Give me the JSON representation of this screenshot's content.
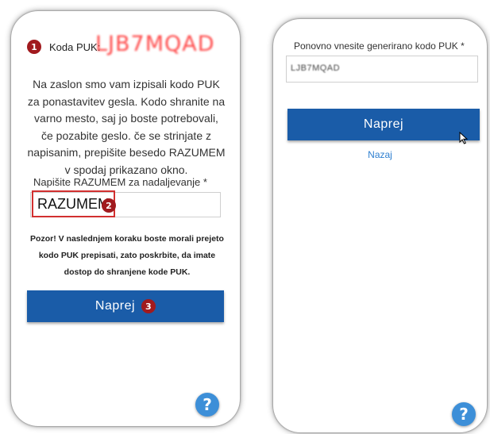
{
  "left_screen": {
    "step1_badge": "1",
    "puk_label": "Koda PUK:",
    "puk_code": "LJB7MQAD",
    "info_text": "Na zaslon smo vam izpisali kodo PUK za ponastavitev gesla. Kodo shranite na varno mesto, saj jo boste potrebovali, če pozabite geslo. če se strinjate z napisanim, prepišite besedo RAZUMEM v spodaj prikazano okno.",
    "field_label": "Napišite RAZUMEM za nadaljevanje *",
    "field_value": "RAZUMEM",
    "step2_badge": "2",
    "warning_text": "Pozor! V naslednjem koraku boste morali prejeto kodo PUK prepisati, zato poskrbite, da imate dostop do shranjene kode PUK.",
    "button_label": "Naprej",
    "step3_badge": "3",
    "help_icon": "?"
  },
  "right_screen": {
    "field_label": "Ponovno vnesite generirano kodo PUK *",
    "field_value": "LJB7MQAD",
    "button_label": "Naprej",
    "back_link": "Nazaj",
    "help_icon": "?"
  },
  "colors": {
    "primary_button": "#1a5ca8",
    "step_badge": "#a11a1e",
    "puk_code": "#ff2a2a",
    "link": "#2e7fd0",
    "help_icon": "#3d8fd8"
  },
  "icons": [
    "help-icon",
    "cursor-icon"
  ]
}
